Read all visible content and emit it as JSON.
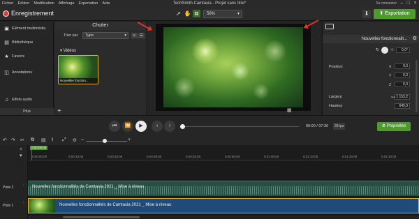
{
  "menubar": {
    "items": [
      "Fichier",
      "Édition",
      "Modification",
      "Affichage",
      "Exportation",
      "Aide"
    ],
    "title": "TechSmith Camtasia - Projet sans titre*",
    "account": "Se connecter"
  },
  "toolbar": {
    "recording_label": "Enregistrement",
    "zoom_value": "56%",
    "export_label": "Exportation"
  },
  "leftnav": {
    "items": [
      "Élément multimédia",
      "Bibliothèque",
      "Favoris",
      "Annotations",
      "Effets audio"
    ],
    "more_label": "Plus"
  },
  "bin": {
    "title": "Chutier",
    "sort_label": "Trier par",
    "sort_value": "Type",
    "group_label": "Vidéos",
    "thumb_caption": "Nouvelles fonction..."
  },
  "properties": {
    "clip_title": "Nouvelles fonctionnalit...",
    "rotation_value": "0,0°",
    "position_label": "Position",
    "axes": [
      "X",
      "Y",
      "Z"
    ],
    "position_values": [
      "0,0",
      "0,0",
      "0,0"
    ],
    "width_label": "Largeur",
    "height_label": "Hauteur",
    "width_value": "1 153,2",
    "height_value": "645,0"
  },
  "transport": {
    "timecode": "00:00 / 07:36",
    "fps": "30 ips",
    "properties_button": "Propriétés"
  },
  "timeline": {
    "playhead": "0:00:00;00",
    "ruler_ticks": [
      "0:00:00;00",
      "0:00:10;00",
      "0:00:20;00",
      "0:00:30;00",
      "0:00:40;00",
      "0:00:50;00",
      "0:01:00;00",
      "0:01:10;00",
      "0:01:20;00",
      "0:01:30;00"
    ],
    "tracks": [
      {
        "label": "Piste 2",
        "clip_title": "Nouvelles fonctionnalités de Camtasia 2021 _ Mise à niveau"
      },
      {
        "label": "Piste 1",
        "clip_title": "Nouvelles fonctionnalités de Camtasia 2021 _ Mise à niveau"
      }
    ]
  },
  "colors": {
    "accent_green": "#4e9a2a",
    "record_red": "#e03b3b",
    "annotation_arrow": "#e0322a",
    "selection_yellow": "#e0b030"
  }
}
